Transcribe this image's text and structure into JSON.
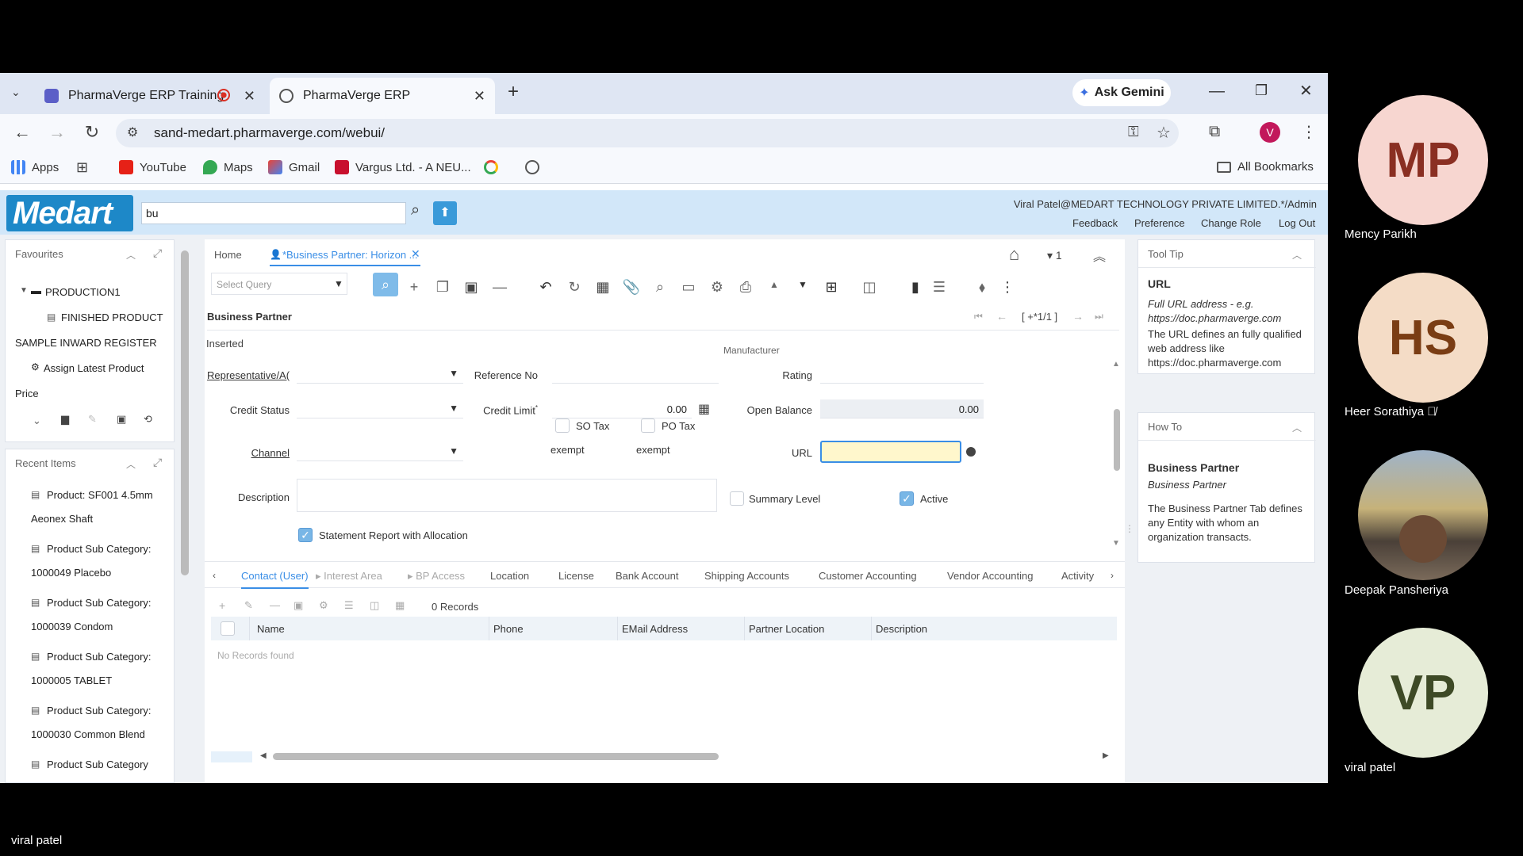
{
  "browser": {
    "tabs": [
      {
        "label": "PharmaVerge ERP Training"
      },
      {
        "label": "PharmaVerge ERP"
      }
    ],
    "ask_gemini": "Ask Gemini",
    "url": "sand-medart.pharmaverge.com/webui/",
    "profile_initial": "V",
    "bookmarks": [
      "Apps",
      "YouTube",
      "Maps",
      "Gmail",
      "Vargus Ltd. - A NEU..."
    ],
    "all_bookmarks": "All Bookmarks"
  },
  "app": {
    "logo": "Medart",
    "search_value": "bu",
    "user": "Viral Patel@MEDART TECHNOLOGY PRIVATE LIMITED.*/Admin",
    "links": [
      "Feedback",
      "Preference",
      "Change Role",
      "Log Out"
    ]
  },
  "favourites": {
    "title": "Favourites",
    "items": [
      "PRODUCTION1",
      "FINISHED PRODUCT",
      "SAMPLE INWARD REGISTER",
      "Assign Latest Product",
      "Price"
    ]
  },
  "recent": {
    "title": "Recent Items",
    "items": [
      {
        "l1": "Product: SF001 4.5mm",
        "l2": "Aeonex Shaft"
      },
      {
        "l1": "Product Sub Category:",
        "l2": "1000049 Placebo"
      },
      {
        "l1": "Product Sub Category:",
        "l2": "1000039 Condom"
      },
      {
        "l1": "Product Sub Category:",
        "l2": "1000005 TABLET"
      },
      {
        "l1": "Product Sub Category:",
        "l2": "1000030 Common Blend"
      },
      {
        "l1": "Product Sub Category",
        "l2": ""
      }
    ]
  },
  "center": {
    "home_tab": "Home",
    "doc_tab": "*Business Partner: Horizon ...",
    "select_query": "Select Query",
    "nav_counter": "[ +*1/1 ]",
    "window_title": "Business Partner",
    "status": "Inserted",
    "cut_label": "Manufacturer",
    "fields": {
      "representative": "Representative/A(",
      "reference_no": "Reference No",
      "rating": "Rating",
      "credit_status": "Credit Status",
      "credit_limit": "Credit Limit",
      "credit_limit_value": "0.00",
      "open_balance": "Open Balance",
      "open_balance_value": "0.00",
      "channel": "Channel",
      "so_tax": "SO Tax",
      "so_tax_2": "exempt",
      "po_tax": "PO Tax",
      "po_tax_2": "exempt",
      "url": "URL",
      "description": "Description",
      "summary_level": "Summary Level",
      "active": "Active",
      "statement_report": "Statement Report with Allocation"
    },
    "detail_tabs": [
      "Contact (User)",
      "Interest Area",
      "BP Access",
      "Location",
      "License",
      "Bank Account",
      "Shipping Accounts",
      "Customer Accounting",
      "Vendor Accounting",
      "Activity"
    ],
    "records": "0 Records",
    "grid_columns": [
      "Name",
      "Phone",
      "EMail Address",
      "Partner Location",
      "Description"
    ],
    "no_records": "No Records found"
  },
  "tooltip": {
    "title": "Tool Tip",
    "heading": "URL",
    "italic": "Full URL address - e.g. https://doc.pharmaverge.com",
    "body": "The URL defines an fully qualified web address like https://doc.pharmaverge.com"
  },
  "howto": {
    "title": "How To",
    "heading": "Business Partner",
    "italic": "Business Partner",
    "body": "The Business Partner Tab defines any Entity with whom an organization transacts."
  },
  "participants": [
    {
      "initials": "MP",
      "name": "Mency Parikh",
      "bg": "#f7d6d0",
      "fg": "#8a2f22"
    },
    {
      "initials": "HS",
      "name": "Heer Sorathiya",
      "bg": "#f4dcc6",
      "fg": "#7a3d14"
    },
    {
      "initials": "",
      "name": "Deepak Pansheriya",
      "bg": "#7a8aa0",
      "fg": "#fff"
    },
    {
      "initials": "VP",
      "name": "viral patel",
      "bg": "#e6ecd7",
      "fg": "#3e4a26"
    }
  ],
  "bottom_name": "viral patel"
}
